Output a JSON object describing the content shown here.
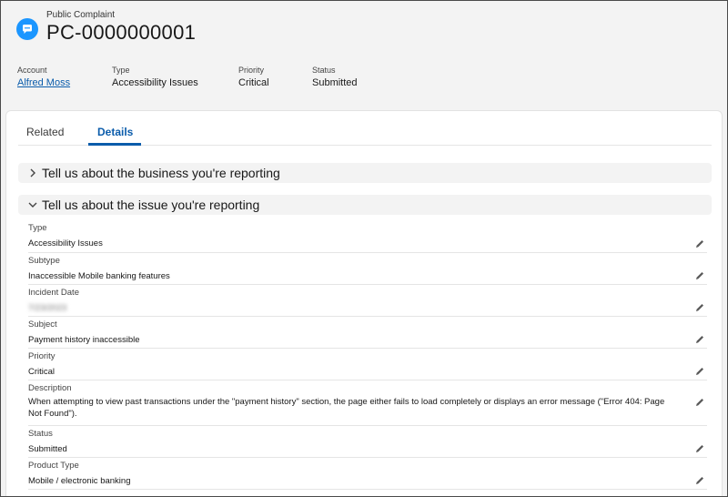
{
  "header": {
    "object_label": "Public Complaint",
    "record_title": "PC-0000000001",
    "icon": "complaint-chat-icon",
    "highlights": [
      {
        "label": "Account",
        "value": "Alfred Moss"
      },
      {
        "label": "Type",
        "value": "Accessibility Issues"
      },
      {
        "label": "Priority",
        "value": "Critical"
      },
      {
        "label": "Status",
        "value": "Submitted"
      }
    ]
  },
  "tabs": [
    {
      "label": "Related",
      "active": false
    },
    {
      "label": "Details",
      "active": true
    }
  ],
  "sections": [
    {
      "title": "Tell us about the business you're reporting",
      "expanded": false
    },
    {
      "title": "Tell us about the issue you're reporting",
      "expanded": true
    }
  ],
  "fields": [
    {
      "label": "Type",
      "value": "Accessibility Issues"
    },
    {
      "label": "Subtype",
      "value": "Inaccessible Mobile banking features"
    },
    {
      "label": "Incident Date",
      "value": "7/23/2023"
    },
    {
      "label": "Subject",
      "value": "Payment history inaccessible"
    },
    {
      "label": "Priority",
      "value": "Critical"
    },
    {
      "label": "Description",
      "value": "When attempting to view past transactions under the \"payment history\" section, the page either fails to load completely or displays an error message (\"Error 404: Page Not Found\")."
    },
    {
      "label": "Status",
      "value": "Submitted"
    },
    {
      "label": "Product Type",
      "value": "Mobile / electronic banking"
    }
  ],
  "colors": {
    "accent": "#0b5cab",
    "icon_bg": "#1b96ff",
    "page_bg": "#f3f3f3",
    "section_bg": "#f3f3f3"
  }
}
